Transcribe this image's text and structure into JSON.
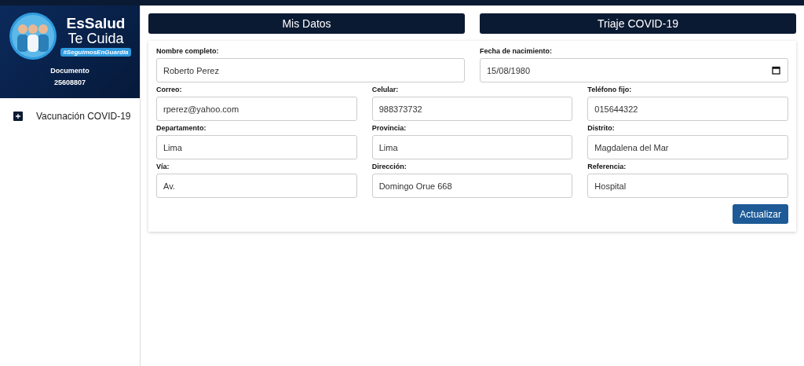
{
  "sidebar": {
    "brand": {
      "title": "EsSalud",
      "subtitle": "Te Cuida",
      "hashtag": "#SeguimosEnGuardia"
    },
    "document_label": "Documento",
    "document_number": "25608807",
    "items": [
      {
        "label": "Vacunación COVID-19"
      }
    ]
  },
  "tabs": [
    {
      "label": "Mis Datos"
    },
    {
      "label": "Triaje COVID-19"
    }
  ],
  "form": {
    "rows": [
      [
        {
          "label": "Nombre completo:",
          "value": "Roberto Perez",
          "kind": "text"
        },
        {
          "label": "Fecha de nacimiento:",
          "value": "15/08/1980",
          "kind": "date"
        }
      ],
      [
        {
          "label": "Correo:",
          "value": "rperez@yahoo.com",
          "kind": "text"
        },
        {
          "label": "Celular:",
          "value": "988373732",
          "kind": "text"
        },
        {
          "label": "Teléfono fijo:",
          "value": "015644322",
          "kind": "text"
        }
      ],
      [
        {
          "label": "Departamento:",
          "value": "Lima",
          "kind": "text"
        },
        {
          "label": "Provincia:",
          "value": "Lima",
          "kind": "text"
        },
        {
          "label": "Distrito:",
          "value": "Magdalena del Mar",
          "kind": "text"
        }
      ],
      [
        {
          "label": "Vía:",
          "value": "Av.",
          "kind": "text"
        },
        {
          "label": "Dirección:",
          "value": "Domingo Orue 668",
          "kind": "text"
        },
        {
          "label": "Referencia:",
          "value": "Hospital",
          "kind": "text"
        }
      ]
    ],
    "submit": "Actualizar"
  }
}
